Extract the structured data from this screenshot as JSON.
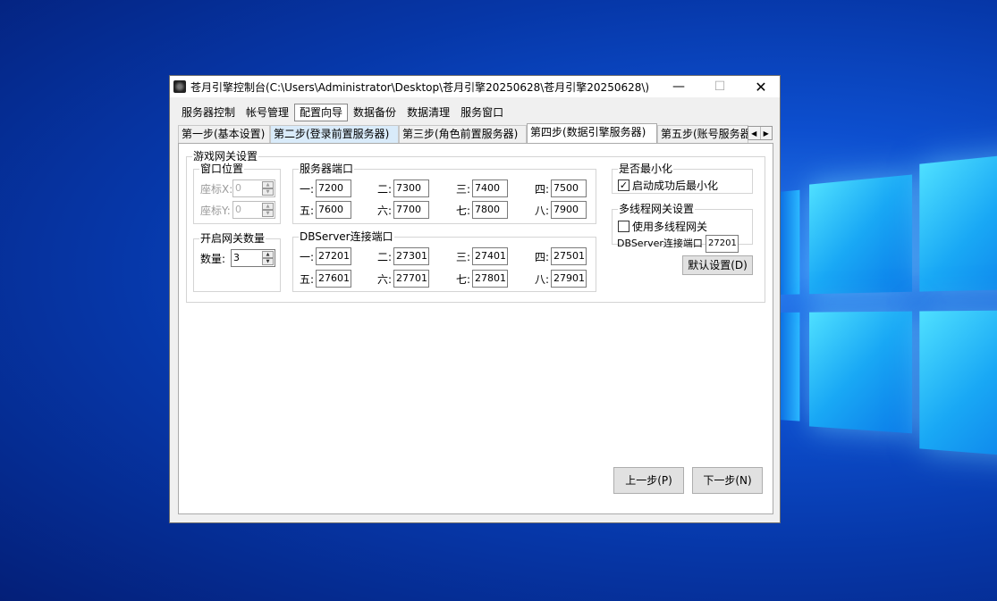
{
  "window": {
    "title": "苍月引擎控制台(C:\\Users\\Administrator\\Desktop\\苍月引擎20250628\\苍月引擎20250628\\)",
    "min_glyph": "—",
    "max_glyph": "☐",
    "close_glyph": "✕"
  },
  "top_tabs": [
    "服务器控制",
    "帐号管理",
    "配置向导",
    "数据备份",
    "数据清理",
    "服务窗口"
  ],
  "sub_tabs": [
    "第一步(基本设置)",
    "第二步(登录前置服务器)",
    "第三步(角色前置服务器)",
    "第四步(数据引擎服务器)",
    "第五步(账号服务器)"
  ],
  "scroll": {
    "left": "◀",
    "right": "▶"
  },
  "gateway": {
    "title": "游戏网关设置",
    "window_pos": {
      "title": "窗口位置",
      "x_label": "座标X:",
      "x_value": "0",
      "y_label": "座标Y:",
      "y_value": "0"
    },
    "gate_count": {
      "title": "开启网关数量",
      "label": "数量:",
      "value": "3"
    },
    "server_port": {
      "title": "服务器端口",
      "ports": [
        {
          "label": "一:",
          "value": "7200"
        },
        {
          "label": "二:",
          "value": "7300"
        },
        {
          "label": "三:",
          "value": "7400"
        },
        {
          "label": "四:",
          "value": "7500"
        },
        {
          "label": "五:",
          "value": "7600"
        },
        {
          "label": "六:",
          "value": "7700"
        },
        {
          "label": "七:",
          "value": "7800"
        },
        {
          "label": "八:",
          "value": "7900"
        }
      ]
    },
    "db_port": {
      "title": "DBServer连接端口",
      "ports": [
        {
          "label": "一:",
          "value": "27201"
        },
        {
          "label": "二:",
          "value": "27301"
        },
        {
          "label": "三:",
          "value": "27401"
        },
        {
          "label": "四:",
          "value": "27501"
        },
        {
          "label": "五:",
          "value": "27601"
        },
        {
          "label": "六:",
          "value": "27701"
        },
        {
          "label": "七:",
          "value": "27801"
        },
        {
          "label": "八:",
          "value": "27901"
        }
      ]
    },
    "minimize": {
      "title": "是否最小化",
      "checkbox_label": "启动成功后最小化",
      "checked_glyph": "✓"
    },
    "multithread": {
      "title": "多线程网关设置",
      "checkbox_label": "使用多线程网关",
      "db_label": "DBServer连接端口",
      "db_value": "27201"
    },
    "default_btn": "默认设置(D)"
  },
  "nav": {
    "prev": "上一步(P)",
    "next": "下一步(N)"
  }
}
